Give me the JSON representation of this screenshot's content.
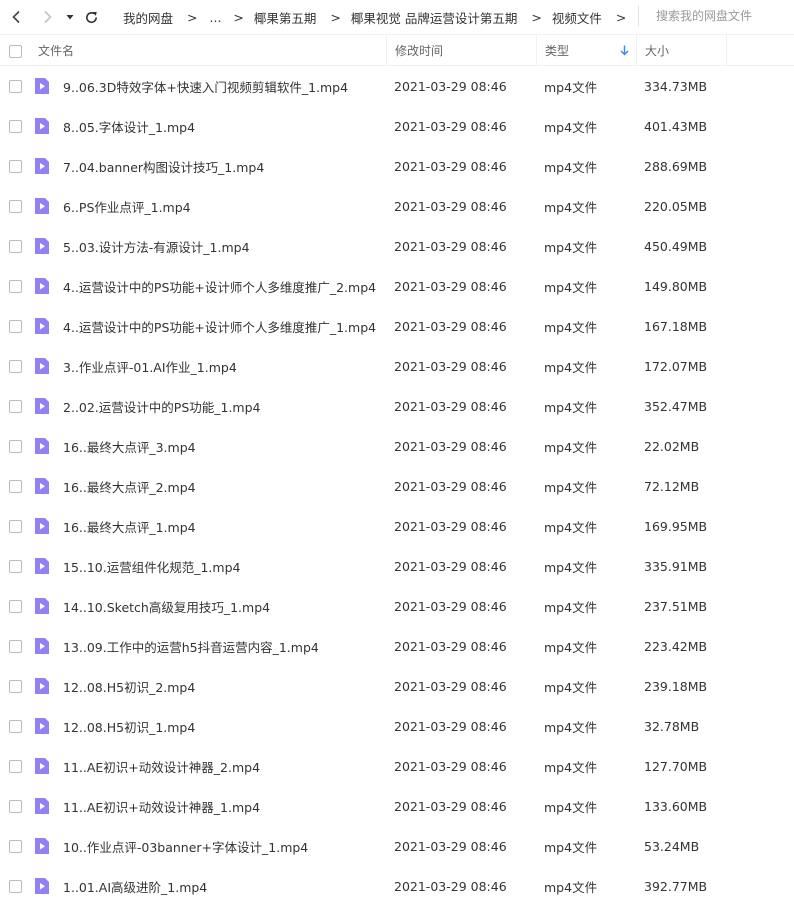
{
  "toolbar": {
    "back_icon": "chevron-left-icon",
    "forward_icon": "chevron-right-icon",
    "history_icon": "caret-down-icon",
    "refresh_icon": "refresh-icon"
  },
  "breadcrumb": {
    "items": [
      "我的网盘",
      "...",
      "椰果第五期",
      "椰果视觉 品牌运营设计第五期",
      "视频文件"
    ],
    "separator": ">"
  },
  "search": {
    "placeholder": "搜索我的网盘文件",
    "value": ""
  },
  "table": {
    "headers": {
      "name": "文件名",
      "time": "修改时间",
      "type": "类型",
      "size": "大小"
    },
    "sort_icon": "sort-down-arrow-icon",
    "accent_color": "#3a8ee6",
    "file_icon_color": "#9181f2",
    "rows": [
      {
        "name": "9..06.3D特效字体+快速入门视频剪辑软件_1.mp4",
        "time": "2021-03-29 08:46",
        "type": "mp4文件",
        "size": "334.73MB"
      },
      {
        "name": "8..05.字体设计_1.mp4",
        "time": "2021-03-29 08:46",
        "type": "mp4文件",
        "size": "401.43MB"
      },
      {
        "name": "7..04.banner构图设计技巧_1.mp4",
        "time": "2021-03-29 08:46",
        "type": "mp4文件",
        "size": "288.69MB"
      },
      {
        "name": "6..PS作业点评_1.mp4",
        "time": "2021-03-29 08:46",
        "type": "mp4文件",
        "size": "220.05MB"
      },
      {
        "name": "5..03.设计方法-有源设计_1.mp4",
        "time": "2021-03-29 08:46",
        "type": "mp4文件",
        "size": "450.49MB"
      },
      {
        "name": "4..运营设计中的PS功能+设计师个人多维度推广_2.mp4",
        "time": "2021-03-29 08:46",
        "type": "mp4文件",
        "size": "149.80MB"
      },
      {
        "name": "4..运营设计中的PS功能+设计师个人多维度推广_1.mp4",
        "time": "2021-03-29 08:46",
        "type": "mp4文件",
        "size": "167.18MB"
      },
      {
        "name": "3..作业点评-01.AI作业_1.mp4",
        "time": "2021-03-29 08:46",
        "type": "mp4文件",
        "size": "172.07MB"
      },
      {
        "name": "2..02.运营设计中的PS功能_1.mp4",
        "time": "2021-03-29 08:46",
        "type": "mp4文件",
        "size": "352.47MB"
      },
      {
        "name": "16..最终大点评_3.mp4",
        "time": "2021-03-29 08:46",
        "type": "mp4文件",
        "size": "22.02MB"
      },
      {
        "name": "16..最终大点评_2.mp4",
        "time": "2021-03-29 08:46",
        "type": "mp4文件",
        "size": "72.12MB"
      },
      {
        "name": "16..最终大点评_1.mp4",
        "time": "2021-03-29 08:46",
        "type": "mp4文件",
        "size": "169.95MB"
      },
      {
        "name": "15..10.运营组件化规范_1.mp4",
        "time": "2021-03-29 08:46",
        "type": "mp4文件",
        "size": "335.91MB"
      },
      {
        "name": "14..10.Sketch高级复用技巧_1.mp4",
        "time": "2021-03-29 08:46",
        "type": "mp4文件",
        "size": "237.51MB"
      },
      {
        "name": "13..09.工作中的运营h5抖音运营内容_1.mp4",
        "time": "2021-03-29 08:46",
        "type": "mp4文件",
        "size": "223.42MB"
      },
      {
        "name": "12..08.H5初识_2.mp4",
        "time": "2021-03-29 08:46",
        "type": "mp4文件",
        "size": "239.18MB"
      },
      {
        "name": "12..08.H5初识_1.mp4",
        "time": "2021-03-29 08:46",
        "type": "mp4文件",
        "size": "32.78MB"
      },
      {
        "name": "11..AE初识+动效设计神器_2.mp4",
        "time": "2021-03-29 08:46",
        "type": "mp4文件",
        "size": "127.70MB"
      },
      {
        "name": "11..AE初识+动效设计神器_1.mp4",
        "time": "2021-03-29 08:46",
        "type": "mp4文件",
        "size": "133.60MB"
      },
      {
        "name": "10..作业点评-03banner+字体设计_1.mp4",
        "time": "2021-03-29 08:46",
        "type": "mp4文件",
        "size": "53.24MB"
      },
      {
        "name": "1..01.AI高级进阶_1.mp4",
        "time": "2021-03-29 08:46",
        "type": "mp4文件",
        "size": "392.77MB"
      }
    ]
  }
}
